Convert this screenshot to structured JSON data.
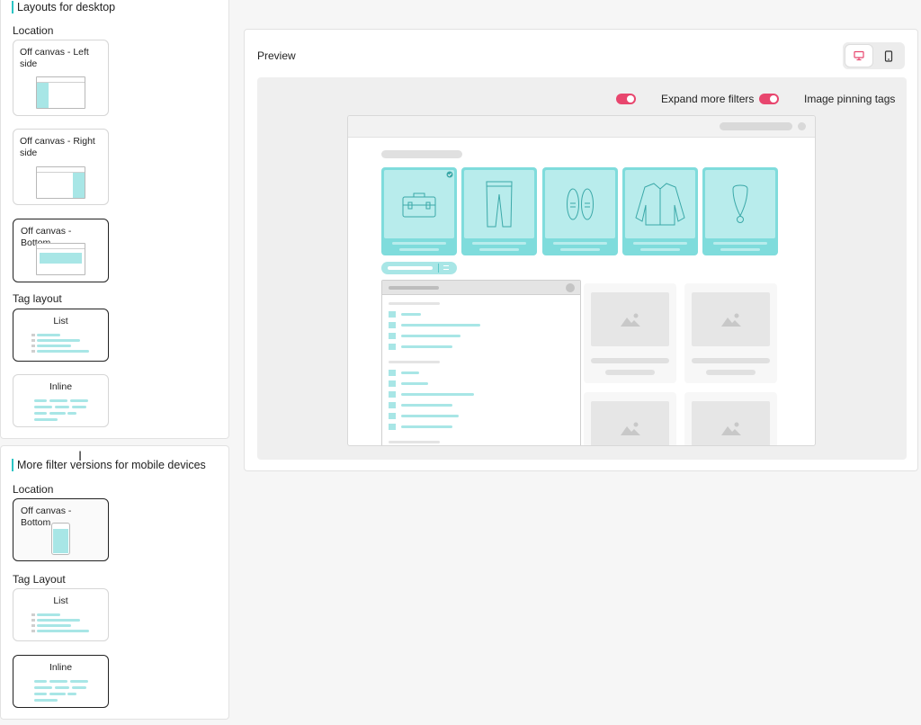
{
  "desktop_panel": {
    "title": "Layouts for desktop",
    "location_label": "Location",
    "location_options": [
      {
        "label": "Off canvas - Left side",
        "selected": false
      },
      {
        "label": "Off canvas - Right side",
        "selected": false
      },
      {
        "label": "Off canvas - Bottom",
        "selected": true
      }
    ],
    "tag_layout_label": "Tag layout",
    "tag_options": [
      {
        "label": "List",
        "selected": true
      },
      {
        "label": "Inline",
        "selected": false
      }
    ]
  },
  "mobile_panel": {
    "title": "More filter versions for mobile devices",
    "location_label": "Location",
    "location_options": [
      {
        "label": "Off canvas - Bottom",
        "selected": true
      }
    ],
    "tag_layout_label": "Tag Layout",
    "tag_options": [
      {
        "label": "List",
        "selected": false
      },
      {
        "label": "Inline",
        "selected": true
      }
    ]
  },
  "preview": {
    "title": "Preview",
    "device": "desktop",
    "toggles": [
      {
        "label": "Expand more filters",
        "on": true
      },
      {
        "label": "Image pinning tags",
        "on": true
      }
    ]
  },
  "colors": {
    "accent": "#2bc4c4",
    "tile": "#7fdcdc",
    "tile_light": "#b8ecec",
    "toggle": "#e8466e",
    "device_icon": "#e8466e"
  },
  "icons": {
    "desktop": "monitor-icon",
    "mobile": "phone-icon",
    "tiles": [
      "bag-icon",
      "pants-icon",
      "shoes-icon",
      "jacket-icon",
      "necklace-icon"
    ]
  }
}
